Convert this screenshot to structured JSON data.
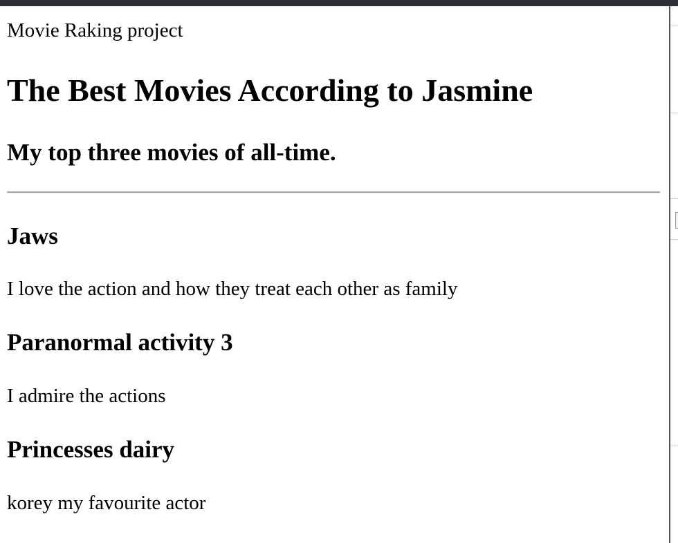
{
  "page": {
    "site_title": "Movie Raking project",
    "heading": "The Best Movies According to Jasmine",
    "subheading": "My top three movies of all-time."
  },
  "movies": [
    {
      "title": "Jaws",
      "note": "I love the action and how they treat each other as family"
    },
    {
      "title": "Paranormal activity 3",
      "note": "I admire the actions"
    },
    {
      "title": "Princesses dairy",
      "note": "korey my favourite actor"
    }
  ],
  "colors": {
    "top_bar": "#2b2f36",
    "rule": "#a9a9a9",
    "text": "#000000"
  }
}
